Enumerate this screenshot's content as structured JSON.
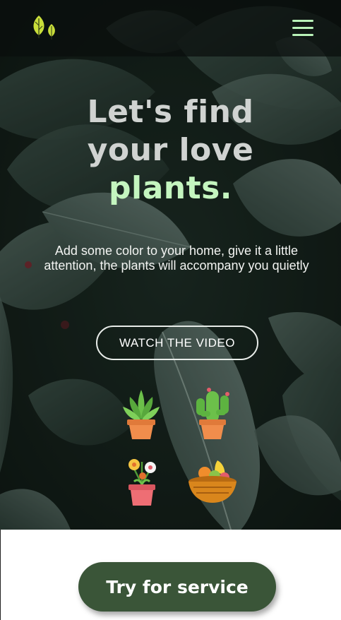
{
  "navbar": {
    "logo_icon": "leaves-logo-icon",
    "menu_icon": "hamburger-menu-icon",
    "accent_color": "#b9f2b8"
  },
  "hero": {
    "headline_line1": "Let's find",
    "headline_line2": "your love",
    "headline_accent": "plants.",
    "subtitle": "Add some color to your home, give it a little attention, the plants will accompany you quietly",
    "watch_button_label": "WATCH THE VIDEO",
    "plant_icons": [
      "succulent-pot-icon",
      "cactus-pot-icon",
      "flower-pot-icon",
      "fruit-bowl-icon"
    ]
  },
  "cta": {
    "try_button_label": "Try for service",
    "button_color": "#3a5538"
  }
}
